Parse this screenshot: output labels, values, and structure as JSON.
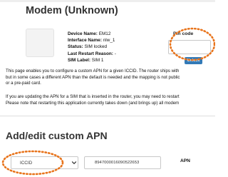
{
  "modem": {
    "title": "Modem (Unknown)",
    "info": [
      {
        "label": "Device Name:",
        "value": "EM12"
      },
      {
        "label": "Interface Name:",
        "value": "nlw_1"
      },
      {
        "label": "Status:",
        "value": "SIM locked"
      },
      {
        "label": "Last Restart Reason:",
        "value": "-"
      },
      {
        "label": "SIM Label:",
        "value": "SIM 1"
      }
    ]
  },
  "pin": {
    "label": "Pin code",
    "value": "",
    "unlock_label": "Unlock"
  },
  "description": {
    "para1": [
      "This page enables you to configure a custom APN for a given ICCID. The router ships with",
      "but in some cases a different APN than the default is needed and the mapping is not public",
      "or a pre-paid card."
    ],
    "para2": [
      "If you are updating the APN for a SIM that is inserted in the router, you may need to restart",
      "Please note that restarting this application currently takes down (and brings up) all modem"
    ]
  },
  "apn_form": {
    "title": "Add/edit custom APN",
    "select_value": "ICCID",
    "iccid_value": "8947000016090522653",
    "apn_label": "APN"
  },
  "annotation_color": "#e8741c"
}
